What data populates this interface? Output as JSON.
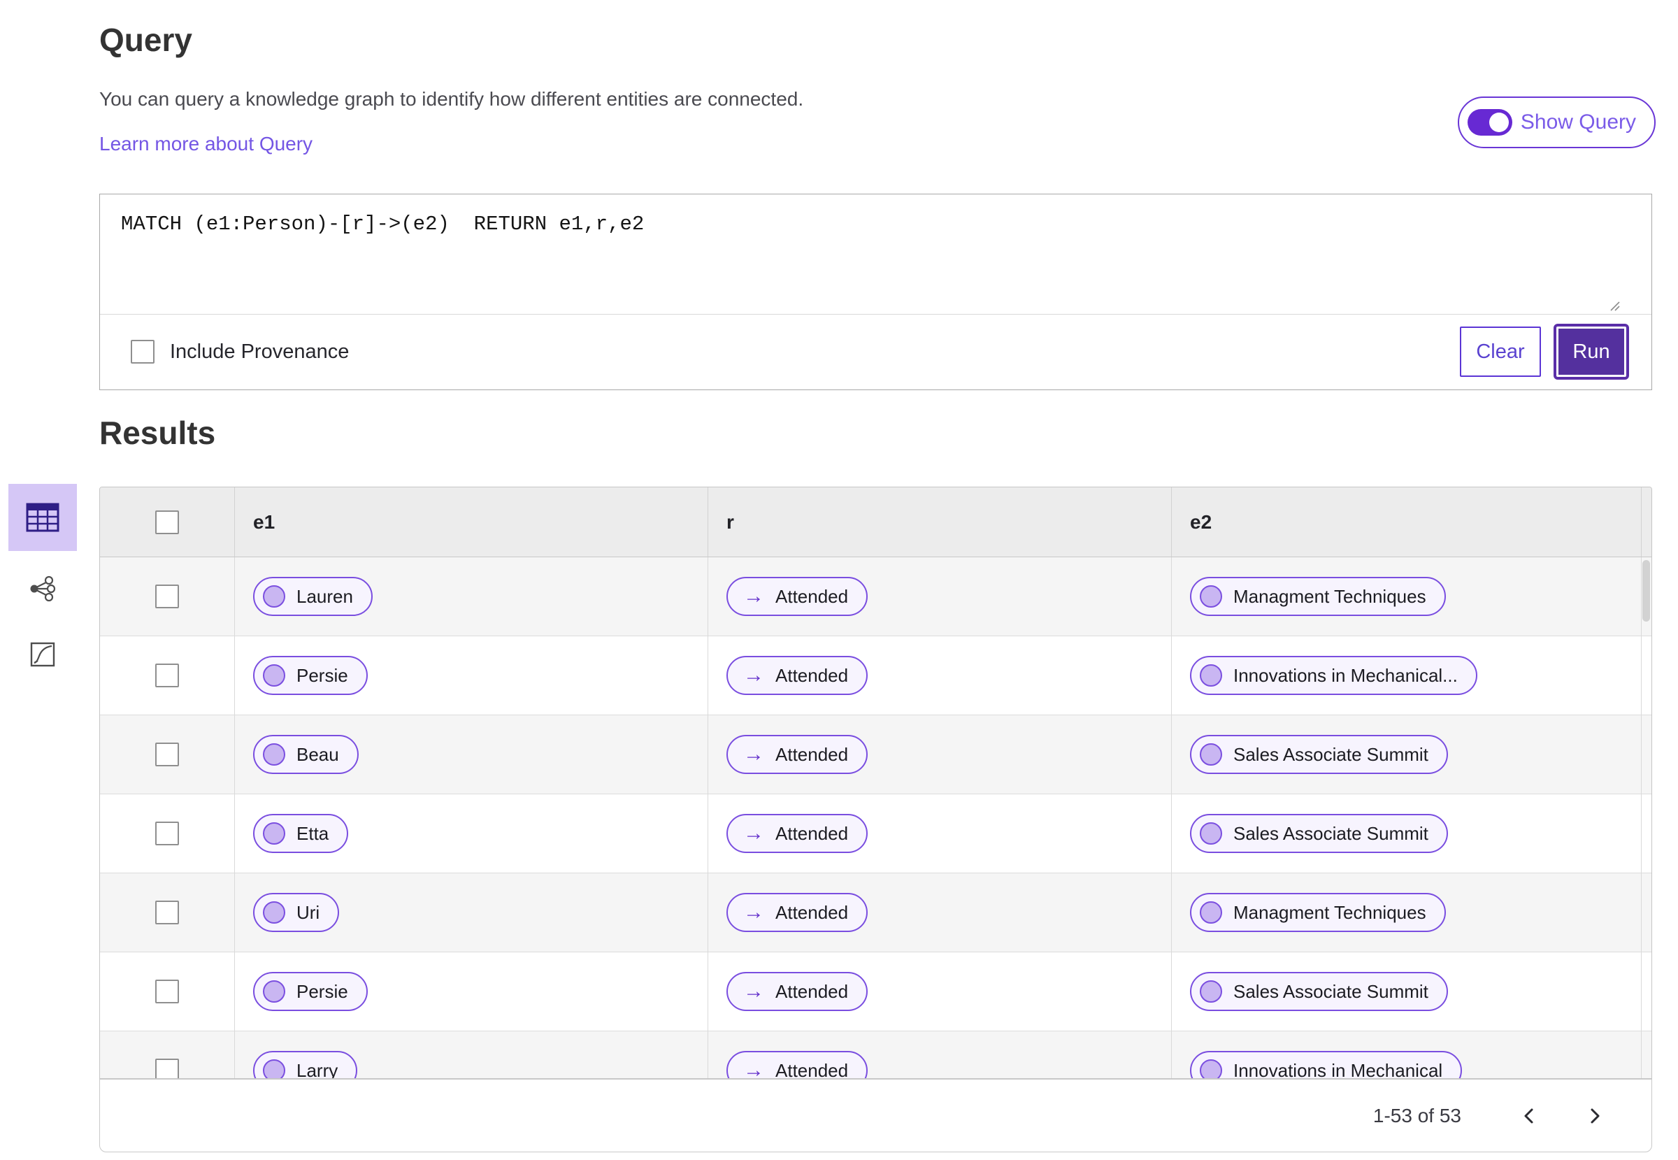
{
  "query_section": {
    "title": "Query",
    "description": "You can query a knowledge graph to identify how different entities are connected.",
    "learn_more_label": "Learn more about Query",
    "show_query_label": "Show Query",
    "show_query_on": true,
    "query_text": "MATCH (e1:Person)-[r]->(e2)  RETURN e1,r,e2",
    "include_provenance_label": "Include Provenance",
    "include_provenance_checked": false,
    "clear_label": "Clear",
    "run_label": "Run"
  },
  "results": {
    "title": "Results",
    "columns": {
      "0": "e1",
      "1": "r",
      "2": "e2"
    },
    "rows": [
      {
        "e1": "Lauren",
        "r": "Attended",
        "e2": "Managment Techniques"
      },
      {
        "e1": "Persie",
        "r": "Attended",
        "e2": "Innovations in Mechanical..."
      },
      {
        "e1": "Beau",
        "r": "Attended",
        "e2": "Sales Associate Summit"
      },
      {
        "e1": "Etta",
        "r": "Attended",
        "e2": "Sales Associate Summit"
      },
      {
        "e1": "Uri",
        "r": "Attended",
        "e2": "Managment Techniques"
      },
      {
        "e1": "Persie",
        "r": "Attended",
        "e2": "Sales Associate Summit"
      },
      {
        "e1": "Larry",
        "r": "Attended",
        "e2": "Innovations in Mechanical"
      }
    ],
    "pagination": {
      "range_label": "1-53 of 53"
    },
    "view_switcher": [
      "table-view",
      "network-view",
      "chart-view"
    ],
    "selected_view": "table-view"
  },
  "icons": {
    "relation_arrow": "→"
  },
  "colors": {
    "accent_purple": "#6729d3",
    "run_button_bg": "#54309e",
    "chip_border": "#7a4ee0",
    "chip_fill": "#f7f4fe",
    "chip_dot": "#c9b6f2",
    "selected_view_bg": "#d5c7f6",
    "link_purple": "#7456e4",
    "header_bg": "#ececec",
    "row_stripe": "#f5f5f5"
  }
}
